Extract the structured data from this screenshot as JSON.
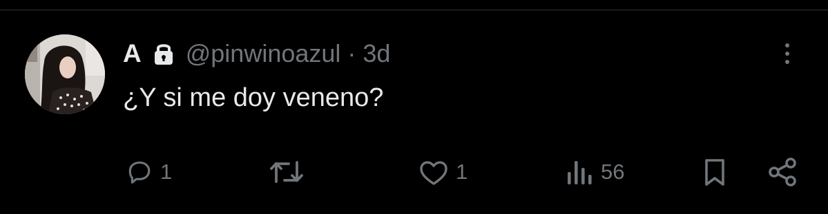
{
  "tweet": {
    "display_name": "A",
    "handle": "@pinwinoazul",
    "separator": "·",
    "timestamp": "3d",
    "text": "¿Y si me doy veneno?",
    "icons": {
      "lock": "lock-icon",
      "more": "more-vertical-icon"
    }
  },
  "actions": {
    "reply": {
      "icon": "reply-icon",
      "count": "1"
    },
    "repost": {
      "icon": "repost-icon",
      "count": ""
    },
    "like": {
      "icon": "heart-icon",
      "count": "1"
    },
    "views": {
      "icon": "views-icon",
      "count": "56"
    },
    "bookmark": {
      "icon": "bookmark-icon"
    },
    "share": {
      "icon": "share-icon"
    }
  },
  "colors": {
    "background": "#000000",
    "primary_text": "#e7e9ea",
    "secondary_text": "#71767b",
    "divider": "#2f3336"
  }
}
